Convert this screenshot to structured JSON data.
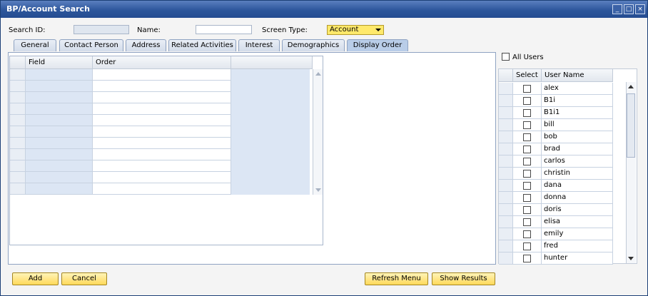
{
  "window": {
    "title": "BP/Account Search"
  },
  "form": {
    "search_id_label": "Search ID:",
    "search_id_value": "",
    "name_label": "Name:",
    "name_value": "",
    "screen_type_label": "Screen Type:",
    "screen_type_value": "Account"
  },
  "tabs": [
    {
      "label": "General"
    },
    {
      "label": "Contact Person"
    },
    {
      "label": "Address"
    },
    {
      "label": "Related Activities"
    },
    {
      "label": "Interest"
    },
    {
      "label": "Demographics"
    },
    {
      "label": "Display Order"
    }
  ],
  "active_tab": "Display Order",
  "display_order_grid": {
    "columns": [
      "Field",
      "Order"
    ],
    "rows": [
      "",
      "",
      "",
      "",
      "",
      "",
      "",
      "",
      "",
      "",
      ""
    ]
  },
  "users_panel": {
    "all_users_label": "All Users",
    "columns": [
      "Select",
      "User Name"
    ],
    "users": [
      "alex",
      "B1i",
      "B1i1",
      "bill",
      "bob",
      "brad",
      "carlos",
      "christin",
      "dana",
      "donna",
      "doris",
      "elisa",
      "emily",
      "fred",
      "hunter"
    ]
  },
  "buttons": {
    "add": "Add",
    "cancel": "Cancel",
    "refresh_menu": "Refresh Menu",
    "show_results": "Show Results"
  }
}
